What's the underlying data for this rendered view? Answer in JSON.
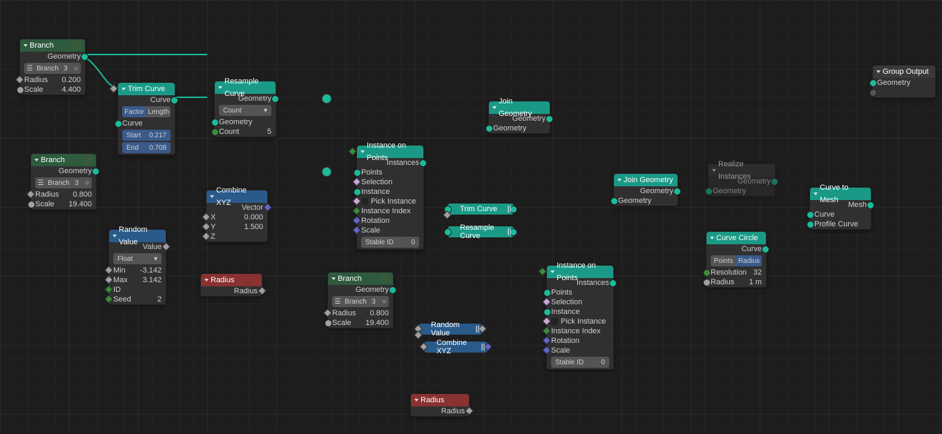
{
  "nodes": {
    "branch1": {
      "title": "Branch",
      "out_geom": "Geometry",
      "sel": "Branch",
      "sel_num": "3",
      "radius_l": "Radius",
      "radius_v": "0.200",
      "scale_l": "Scale",
      "scale_v": "4.400"
    },
    "trim1": {
      "title": "Trim Curve",
      "out_curve": "Curve",
      "btn_a": "Factor",
      "btn_b": "Length",
      "curve": "Curve",
      "start_l": "Start",
      "start_v": "0.217",
      "end_l": "End",
      "end_v": "0.708"
    },
    "resample1": {
      "title": "Resample Curve",
      "out_geom": "Geometry",
      "mode": "Count",
      "curve": "Geometry",
      "count_l": "Count",
      "count_v": "5"
    },
    "branch2": {
      "title": "Branch",
      "out_geom": "Geometry",
      "sel": "Branch",
      "sel_num": "3",
      "radius_l": "Radius",
      "radius_v": "0.800",
      "scale_l": "Scale",
      "scale_v": "19.400"
    },
    "combine1": {
      "title": "Combine XYZ",
      "out": "Vector",
      "x_l": "X",
      "x_v": "0.000",
      "y_l": "Y",
      "y_v": "1.500",
      "z_l": "Z"
    },
    "random1": {
      "title": "Random Value",
      "out": "Value",
      "mode": "Float",
      "min_l": "Min",
      "min_v": "-3.142",
      "max_l": "Max",
      "max_v": "3.142",
      "id_l": "ID",
      "seed_l": "Seed",
      "seed_v": "2"
    },
    "radius1": {
      "title": "Radius",
      "out": "Radius"
    },
    "iop1": {
      "title": "Instance on Points",
      "out": "Instances",
      "points": "Points",
      "selection": "Selection",
      "instance": "Instance",
      "pick": "Pick Instance",
      "index": "Instance Index",
      "rotation": "Rotation",
      "scale": "Scale",
      "stable_l": "Stable ID",
      "stable_v": "0"
    },
    "trim_mini": {
      "title": "Trim Curve"
    },
    "resample_mini": {
      "title": "Resample Curve"
    },
    "join1": {
      "title": "Join Geometry",
      "out": "Geometry",
      "in": "Geometry"
    },
    "join2": {
      "title": "Join Geometry",
      "out": "Geometry",
      "in": "Geometry"
    },
    "branch3": {
      "title": "Branch",
      "out_geom": "Geometry",
      "sel": "Branch",
      "sel_num": "3",
      "radius_l": "Radius",
      "radius_v": "0.800",
      "scale_l": "Scale",
      "scale_v": "19.400"
    },
    "random_mini": {
      "title": "Random Value"
    },
    "combine_mini": {
      "title": "Combine XYZ"
    },
    "radius2": {
      "title": "Radius",
      "out": "Radius"
    },
    "iop2": {
      "title": "Instance on Points",
      "out": "Instances",
      "points": "Points",
      "selection": "Selection",
      "instance": "Instance",
      "pick": "Pick Instance",
      "index": "Instance Index",
      "rotation": "Rotation",
      "scale": "Scale",
      "stable_l": "Stable ID",
      "stable_v": "0"
    },
    "realize": {
      "title": "Realize Instances",
      "out": "Geometry",
      "in": "Geometry"
    },
    "ctm": {
      "title": "Curve to Mesh",
      "out": "Mesh",
      "curve": "Curve",
      "profile": "Profile Curve"
    },
    "circle": {
      "title": "Curve Circle",
      "out": "Curve",
      "btn_a": "Points",
      "btn_b": "Radius",
      "res_l": "Resolution",
      "res_v": "32",
      "rad_l": "Radius",
      "rad_v": "1 m"
    },
    "gout": {
      "title": "Group Output",
      "in": "Geometry"
    }
  }
}
